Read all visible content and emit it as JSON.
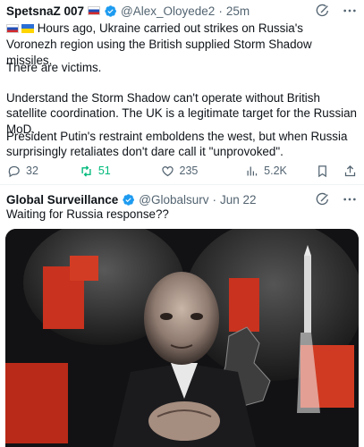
{
  "tweet1": {
    "author_name": "SpetsnaZ 007",
    "handle": "@Alex_Oloyede2",
    "separator": "·",
    "time": "25m",
    "para1_rest": " Hours ago, Ukraine carried out strikes on Russia's Voronezh region using the British supplied Storm Shadow missiles.",
    "para2": "There are victims.",
    "para3": "Understand the Storm Shadow can't operate without British satellite coordination. The UK is a legitimate target for the Russian MoD.",
    "para4": "President Putin's restraint emboldens the west, but when Russia surprisingly retaliates don't dare call it \"unprovoked\".",
    "replies": "32",
    "reposts": "51",
    "likes": "235",
    "views": "5.2K",
    "icons": [
      "flag-russia-icon",
      "flag-ukraine-icon",
      "verified-badge-icon",
      "grok-icon",
      "more-icon",
      "reply-icon",
      "repost-icon",
      "like-icon",
      "views-icon",
      "bookmark-icon",
      "share-icon"
    ]
  },
  "tweet2": {
    "author_name": "Global Surveillance",
    "handle": "@Globalsurv",
    "separator": "·",
    "time": "Jun 22",
    "text": "Waiting for Russia response??",
    "media_description_icons": [
      "tweet-image"
    ]
  },
  "colors": {
    "text": "#0f1419",
    "secondary": "#536471",
    "verified": "#1d9bf0",
    "repost_active": "#00ba7c",
    "divider": "#eff3f4"
  }
}
